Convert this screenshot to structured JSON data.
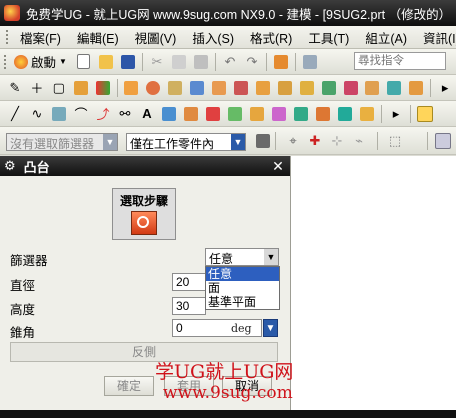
{
  "window": {
    "title": "免费学UG - 就上UG网 www.9sug.com   NX9.0 - 建模 - [9SUG2.prt （修改的）"
  },
  "menubar": {
    "items": [
      "檔案(F)",
      "編輯(E)",
      "視圖(V)",
      "插入(S)",
      "格式(R)",
      "工具(T)",
      "組立(A)",
      "資訊(I)"
    ]
  },
  "toolbar": {
    "start_label": "啟動",
    "search_placeholder": "尋找指令"
  },
  "selection_bar": {
    "filter_value": "沒有選取篩選器",
    "scope_value": "僅在工作零件內"
  },
  "dialog": {
    "title": "凸台",
    "step_label": "選取步驟",
    "filter_label": "篩選器",
    "filter_value": "任意",
    "diameter_label": "直徑",
    "diameter_value": "20",
    "height_label": "高度",
    "height_value": "30",
    "taper_label": "錐角",
    "taper_value": "0",
    "taper_unit": "deg",
    "reverse_label": "反側",
    "ok_label": "確定",
    "apply_label": "套用",
    "cancel_label": "取消",
    "dropdown_options": [
      "任意",
      "面",
      "基準平面"
    ],
    "dropdown_selected": "任意"
  },
  "watermark": {
    "line1": "学UG就上UG网",
    "line2": "www.9sug.com"
  },
  "colors": {
    "titlebar": "#111111",
    "selection_highlight": "#2d5fbf",
    "watermark": "#d0121a",
    "step_icon": "#e0542a"
  }
}
